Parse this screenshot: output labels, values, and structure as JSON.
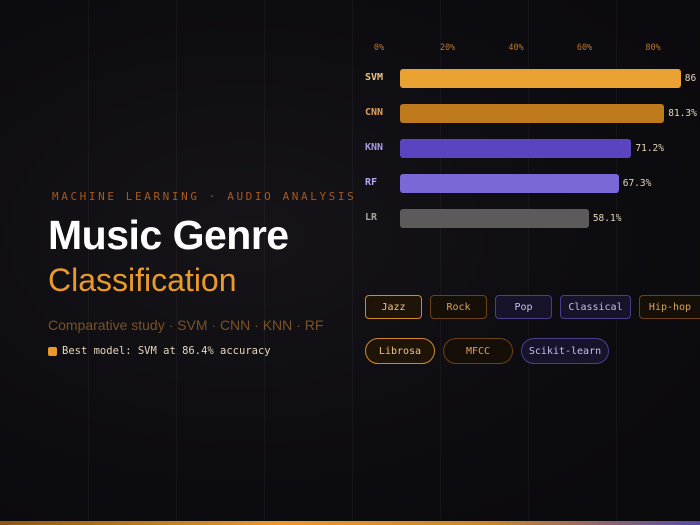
{
  "hero": {
    "eyebrow": "MACHINE LEARNING · AUDIO ANALYSIS",
    "title": "Music Genre",
    "subtitle": "Classification",
    "study": "Comparative study · SVM · CNN · KNN · RF",
    "best": "Best model: SVM at 86.4% accuracy"
  },
  "colors": {
    "accent_orange": "#e99a2b",
    "dark_orange": "#c07a1e",
    "purple": "#5b44c0",
    "light_purple": "#7a68d6",
    "gray": "#5d5a5b"
  },
  "chart_data": {
    "type": "bar",
    "orientation": "horizontal",
    "categories": [
      "SVM",
      "CNN",
      "KNN",
      "RF",
      "LR"
    ],
    "values": [
      86.4,
      81.3,
      71.2,
      67.3,
      58.1
    ],
    "value_labels": [
      "86",
      "81.3%",
      "71.2%",
      "67.3%",
      "58.1%"
    ],
    "ticks": [
      "0%",
      "20%",
      "40%",
      "60%",
      "80%"
    ],
    "xlim": [
      0,
      100
    ],
    "bar_colors": [
      "#e9a132",
      "#c07a1e",
      "#5b44c0",
      "#7a68d6",
      "#5d5a5b"
    ],
    "label_colors": [
      "#f0c585",
      "#e0a25a",
      "#a99ae6",
      "#b6a9ef",
      "#a8a4a0"
    ]
  },
  "genres": [
    "Jazz",
    "Rock",
    "Pop",
    "Classical",
    "Hip-hop"
  ],
  "tools": [
    "Librosa",
    "MFCC",
    "Scikit-learn"
  ]
}
